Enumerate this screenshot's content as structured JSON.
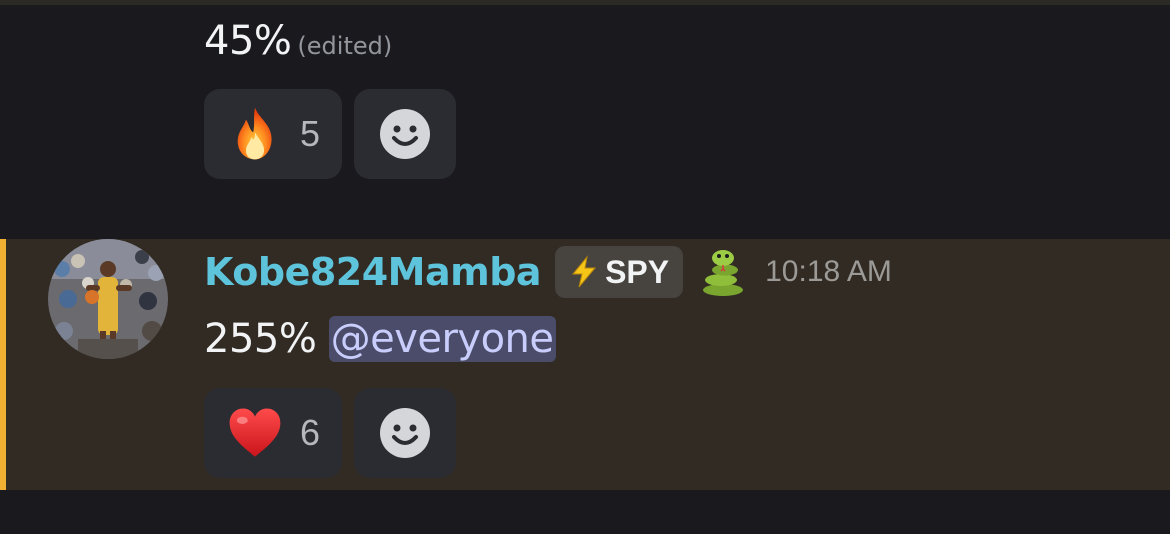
{
  "previous_message": {
    "text": "45%",
    "edited_label": "(edited)",
    "reactions": [
      {
        "emoji": "fire-icon",
        "count": "5"
      },
      {
        "emoji": "add-reaction-icon"
      }
    ]
  },
  "message": {
    "username": "Kobe824Mamba",
    "tag": {
      "icon": "lightning-icon",
      "label": "SPY"
    },
    "badge_icon": "snake-icon",
    "timestamp": "10:18 AM",
    "text": "255%",
    "mention": "@everyone",
    "reactions": [
      {
        "emoji": "heart-icon",
        "count": "6"
      },
      {
        "emoji": "add-reaction-icon"
      }
    ]
  },
  "colors": {
    "username": "#5ec4dc",
    "highlight_bar": "#f0b132",
    "highlight_bg": "#312b24",
    "mention_bg": "#4a4c6a",
    "mention_text": "#c9cdfb",
    "background": "#1a1a1e"
  }
}
